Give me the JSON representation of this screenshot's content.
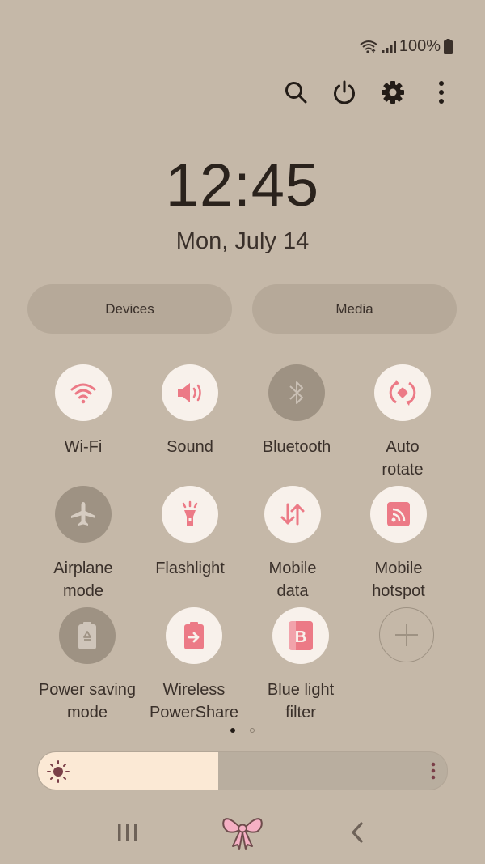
{
  "status_bar": {
    "battery_text": "100%",
    "icons": [
      "wifi-icon",
      "signal-icon",
      "battery-icon"
    ]
  },
  "top_actions": [
    {
      "name": "search",
      "icon": "search-icon"
    },
    {
      "name": "power",
      "icon": "power-icon"
    },
    {
      "name": "settings",
      "icon": "gear-icon"
    },
    {
      "name": "more",
      "icon": "more-vertical-icon"
    }
  ],
  "clock": {
    "time": "12:45",
    "date": "Mon, July 14"
  },
  "pills": {
    "devices": "Devices",
    "media": "Media"
  },
  "tiles": [
    {
      "label": "Wi-Fi",
      "icon": "wifi-icon",
      "state": "on"
    },
    {
      "label": "Sound",
      "icon": "sound-icon",
      "state": "on"
    },
    {
      "label": "Bluetooth",
      "icon": "bluetooth-icon",
      "state": "off"
    },
    {
      "label": "Auto\nrotate",
      "icon": "auto-rotate-icon",
      "state": "on"
    },
    {
      "label": "Airplane\nmode",
      "icon": "airplane-icon",
      "state": "off"
    },
    {
      "label": "Flashlight",
      "icon": "flashlight-icon",
      "state": "on"
    },
    {
      "label": "Mobile\ndata",
      "icon": "mobile-data-icon",
      "state": "on"
    },
    {
      "label": "Mobile\nhotspot",
      "icon": "hotspot-icon",
      "state": "on"
    },
    {
      "label": "Power saving\nmode",
      "icon": "power-saving-icon",
      "state": "off"
    },
    {
      "label": "Wireless\nPowerShare",
      "icon": "wireless-powershare-icon",
      "state": "on"
    },
    {
      "label": "Blue light\nfilter",
      "icon": "blue-light-filter-icon",
      "state": "on"
    },
    {
      "label": "",
      "icon": "add-icon",
      "state": "add"
    }
  ],
  "pager": {
    "current": 1,
    "total": 2
  },
  "brightness": {
    "level_percent": 44
  },
  "nav_bar": {
    "recents": "recents-icon",
    "home": "bow-home-icon",
    "back": "back-icon"
  },
  "colors": {
    "accent": "#ec7a86",
    "background": "#c5b8a8",
    "tile_on": "#f8f1eb",
    "tile_off": "#9e9283"
  }
}
